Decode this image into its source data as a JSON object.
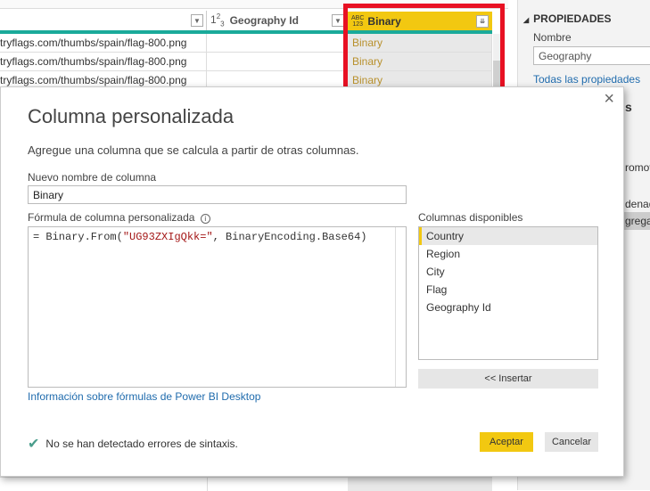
{
  "grid": {
    "columns": [
      {
        "label": "Geography Id",
        "type_icon": "1²₃"
      },
      {
        "label": "Binary",
        "type_icon": "ABC/123"
      }
    ],
    "rows": [
      {
        "url": "tryflags.com/thumbs/spain/flag-800.png",
        "binary": "Binary"
      },
      {
        "url": "tryflags.com/thumbs/spain/flag-800.png",
        "binary": "Binary"
      },
      {
        "url": "tryflags.com/thumbs/spain/flag-800.png",
        "binary": "Binary"
      }
    ]
  },
  "properties": {
    "heading": "PROPIEDADES",
    "name_label": "Nombre",
    "name_value": "Geography",
    "all_link": "Todas las propiedades",
    "partial_texts": [
      "s",
      "romov",
      "denad",
      "grega"
    ]
  },
  "dialog": {
    "title": "Columna personalizada",
    "subtitle": "Agregue una columna que se calcula a partir de otras columnas.",
    "name_label": "Nuevo nombre de columna",
    "name_value": "Binary",
    "formula_label": "Fórmula de columna personalizada",
    "formula_prefix": "= Binary.From(",
    "formula_string": "\"UG93ZXIgQkk=\"",
    "formula_suffix": ", BinaryEncoding.Base64)",
    "columns_label": "Columnas disponibles",
    "columns": [
      "Country",
      "Region",
      "City",
      "Flag",
      "Geography Id"
    ],
    "insert_button": "<< Insertar",
    "help_link": "Información sobre fórmulas de Power BI Desktop",
    "status": "No se han detectado errores de sintaxis.",
    "ok_button": "Aceptar",
    "cancel_button": "Cancelar"
  },
  "colors": {
    "accent": "#f2c811",
    "highlight_box": "#e81123",
    "teal": "#1aaa9a",
    "link": "#1f6bad"
  }
}
